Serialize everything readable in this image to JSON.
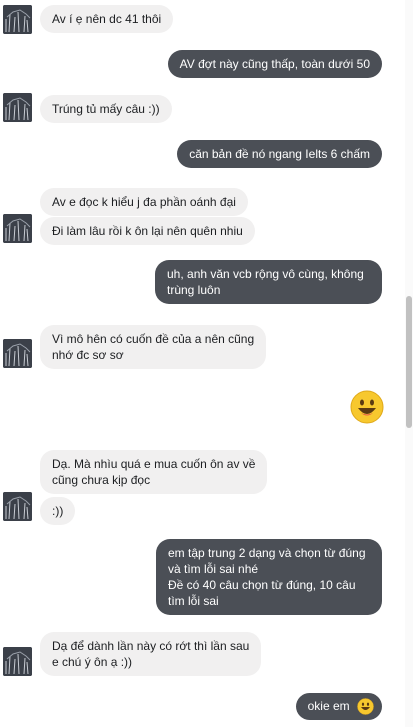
{
  "messages": [
    {
      "from": "them",
      "text": "Av í ẹ nên dc 41 thôi",
      "avatar": true
    },
    {
      "from": "me",
      "text": "AV đợt này cũng thấp, toàn dưới 50"
    },
    {
      "from": "them",
      "text": "Trúng tủ mấy câu :))",
      "avatar": true
    },
    {
      "from": "me",
      "text": "căn bản đề nó ngang Ielts 6 chấm"
    },
    {
      "from": "them",
      "text": "Av e đọc k hiểu j đa phần oánh đại",
      "avatar": false
    },
    {
      "from": "them",
      "text": "Đi làm lâu rồi k ôn lại nên quên nhiu",
      "avatar": true
    },
    {
      "from": "me",
      "lines": [
        "uh, anh văn vcb rộng vô cùng, không",
        "trùng luôn"
      ]
    },
    {
      "from": "them",
      "lines": [
        "Vì mô hên có cuốn đề của a nên cũng",
        "nhớ đc sơ sơ"
      ],
      "avatar": true
    },
    {
      "from": "me",
      "emoji": "grinning-face-emoji"
    },
    {
      "from": "them",
      "lines": [
        "Dạ. Mà nhìu quá e mua cuốn ôn av về",
        "cũng chưa kịp đọc"
      ],
      "avatar": false
    },
    {
      "from": "them",
      "text": ":))",
      "avatar": true
    },
    {
      "from": "me",
      "lines": [
        "em tập trung 2 dạng và chọn từ đúng",
        "và tìm lỗi sai nhé",
        "Đề có 40 câu chọn từ đúng, 10 câu",
        "tìm lỗi sai"
      ]
    },
    {
      "from": "them",
      "lines": [
        "Dạ để dành lần này có rớt thì lần sau",
        "e chú ý ôn ạ :))"
      ],
      "avatar": true
    },
    {
      "from": "me",
      "text": "okie em",
      "emoji": "grinning-face-emoji"
    }
  ],
  "colors": {
    "incoming_bubble": "#f1f0f0",
    "outgoing_bubble": "#4b4f56",
    "emoji_yellow": "#f7c82e"
  }
}
